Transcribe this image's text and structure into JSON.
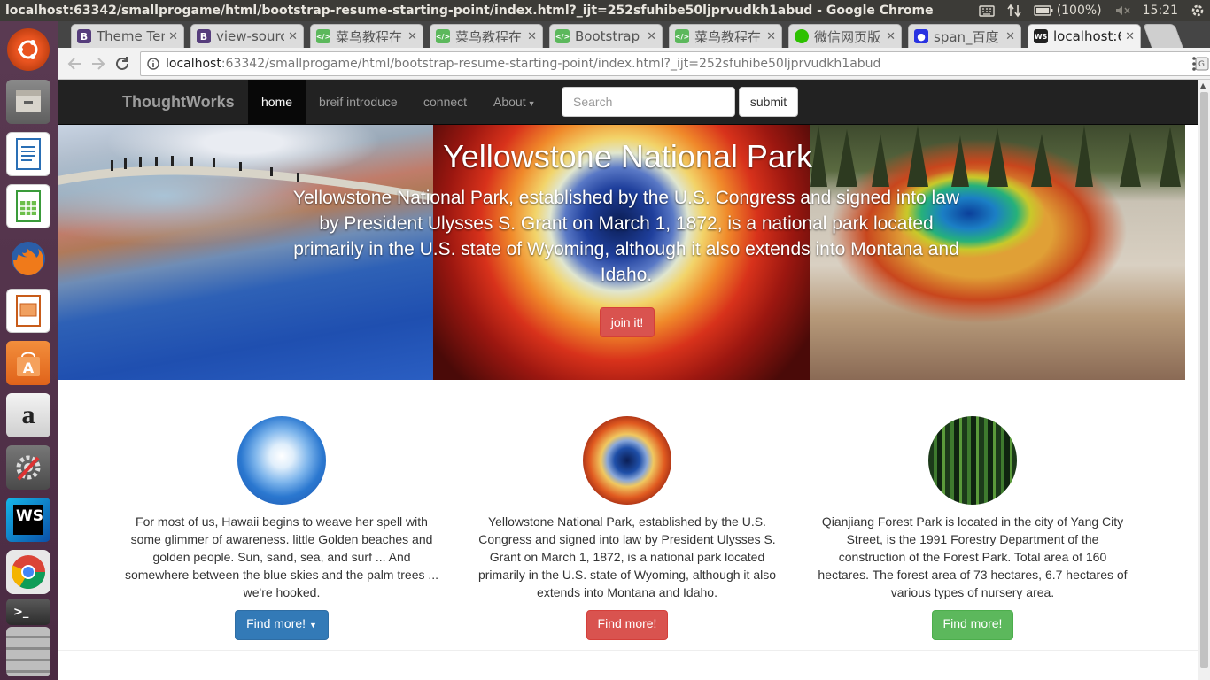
{
  "os": {
    "window_title": "localhost:63342/smallprogame/html/bootstrap-resume-starting-point/index.html?_ijt=252sfuhibe50ljprvudkh1abud - Google Chrome",
    "battery": "(100%)",
    "clock": "15:21"
  },
  "launcher": {
    "items": [
      {
        "name": "ubuntu-icon"
      },
      {
        "name": "files-icon"
      },
      {
        "name": "writer-icon"
      },
      {
        "name": "calc-icon"
      },
      {
        "name": "firefox-icon"
      },
      {
        "name": "impress-icon"
      },
      {
        "name": "software-center-icon"
      },
      {
        "name": "amazon-icon",
        "label": "a"
      },
      {
        "name": "settings-icon"
      },
      {
        "name": "webstorm-icon",
        "label": "WS"
      },
      {
        "name": "chrome-icon"
      },
      {
        "name": "terminal-icon",
        "label": ">_"
      }
    ]
  },
  "tabs": [
    {
      "label": "Theme Ten",
      "icon": "B",
      "color": "#563d7c"
    },
    {
      "label": "view-sourc",
      "icon": "B",
      "color": "#563d7c"
    },
    {
      "label": "菜鸟教程在",
      "icon": "</>",
      "color": "#5cb85c"
    },
    {
      "label": "菜鸟教程在",
      "icon": "</>",
      "color": "#5cb85c"
    },
    {
      "label": "Bootstrap",
      "icon": "</>",
      "color": "#5cb85c"
    },
    {
      "label": "菜鸟教程在",
      "icon": "</>",
      "color": "#5cb85c"
    },
    {
      "label": "微信网页版",
      "icon": "",
      "color": "#2dc100"
    },
    {
      "label": "span_百度",
      "icon": "",
      "color": "#2932e1"
    },
    {
      "label": "localhost:6",
      "icon": "WS",
      "color": "#222",
      "active": true
    }
  ],
  "address": {
    "host": "localhost",
    "rest": ":63342/smallprogame/html/bootstrap-resume-starting-point/index.html?_ijt=252sfuhibe50ljprvudkh1abud"
  },
  "navbar": {
    "brand": "ThoughtWorks",
    "home": "home",
    "intro": "breif introduce",
    "connect": "connect",
    "about": "About",
    "search_placeholder": "Search",
    "submit": "submit"
  },
  "hero": {
    "title": "Yellowstone National Park",
    "text": "Yellowstone National Park, established by the U.S. Congress and signed into law by President Ulysses S. Grant on March 1, 1872, is a national park located primarily in the U.S. state of Wyoming, although it also extends into Montana and Idaho.",
    "button": "join it!"
  },
  "columns": [
    {
      "text": "For most of us, Hawaii begins to weave her spell with some glimmer of awareness. little Golden beaches and golden people. Sun, sand, sea, and surf ... And somewhere between the blue skies and the palm trees ... we're hooked.",
      "button": "Find more!"
    },
    {
      "text": "Yellowstone National Park, established by the U.S. Congress and signed into law by President Ulysses S. Grant on March 1, 1872, is a national park located primarily in the U.S. state of Wyoming, although it also extends into Montana and Idaho.",
      "button": "Find more!"
    },
    {
      "text": "Qianjiang Forest Park is located in the city of Yang City Street, is the 1991 Forestry Department of the construction of the Forest Park. Total area of 160 hectares. The forest area of 73 hectares, 6.7 hectares of various types of nursery area.",
      "button": "Find more!"
    }
  ]
}
